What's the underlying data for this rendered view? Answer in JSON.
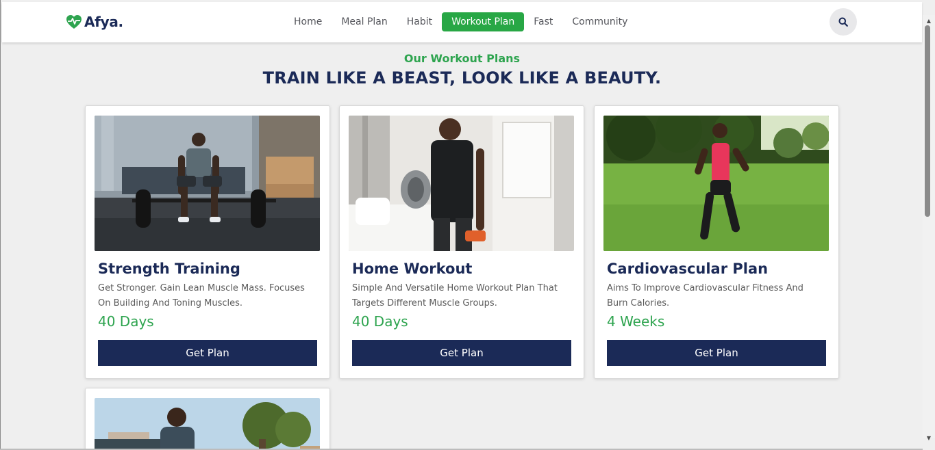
{
  "brand": {
    "name": "Afya."
  },
  "nav": {
    "items": [
      {
        "label": "Home",
        "active": false
      },
      {
        "label": "Meal Plan",
        "active": false
      },
      {
        "label": "Habit",
        "active": false
      },
      {
        "label": "Workout Plan",
        "active": true
      },
      {
        "label": "Fast",
        "active": false
      },
      {
        "label": "Community",
        "active": false
      }
    ],
    "search_icon": "search-icon"
  },
  "section": {
    "subtitle": "Our Workout Plans",
    "title": "TRAIN LIKE A BEAST, LOOK LIKE A BEAUTY."
  },
  "cards": [
    {
      "title": "Strength Training",
      "description": "Get Stronger. Gain Lean Muscle Mass. Focuses On Building And Toning Muscles.",
      "duration": "40 Days",
      "button": "Get Plan"
    },
    {
      "title": "Home Workout",
      "description": "Simple And Versatile Home Workout Plan That Targets Different Muscle Groups.",
      "duration": "40 Days",
      "button": "Get Plan"
    },
    {
      "title": "Cardiovascular Plan",
      "description": "Aims To Improve Cardiovascular Fitness And Burn Calories.",
      "duration": "4 Weeks",
      "button": "Get Plan"
    }
  ],
  "colors": {
    "accent_green": "#2ea44f",
    "navy": "#1b2a57",
    "background": "#efefef"
  }
}
